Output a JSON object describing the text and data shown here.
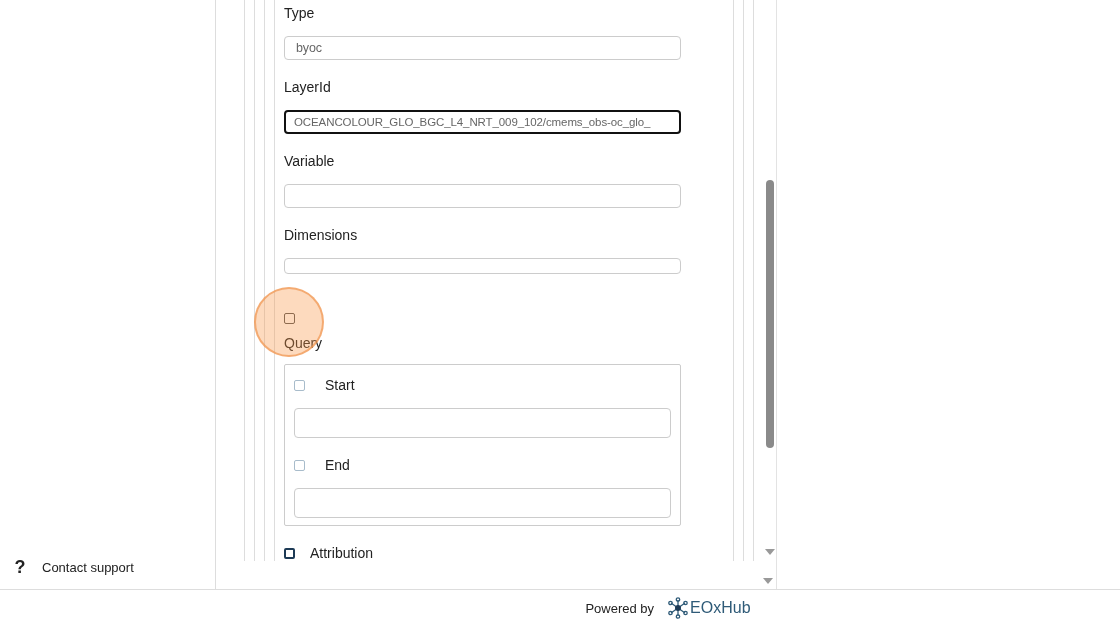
{
  "sidebar": {
    "support_link": {
      "icon": "?",
      "label": "Contact support"
    }
  },
  "form": {
    "fields": [
      {
        "kind": "text",
        "label": "Type",
        "value": "byoc",
        "focused": false
      },
      {
        "kind": "text",
        "label": "LayerId",
        "value": "OCEANCOLOUR_GLO_BGC_L4_NRT_009_102/cmems_obs-oc_glo_",
        "focused": true
      },
      {
        "kind": "text",
        "label": "Variable",
        "focused": false
      },
      {
        "kind": "textarea",
        "label": "Dimensions",
        "focused": false
      },
      {
        "kind": "group",
        "label": "Query",
        "checked": false,
        "children": [
          {
            "label": "Start",
            "checked": false,
            "disabled": true
          },
          {
            "label": "End",
            "checked": false,
            "disabled": true
          }
        ]
      },
      {
        "kind": "checkbox",
        "label": "Attribution",
        "checked": false
      }
    ]
  },
  "footer": {
    "powered_by": "Powered by",
    "brand": "EOxHub"
  }
}
